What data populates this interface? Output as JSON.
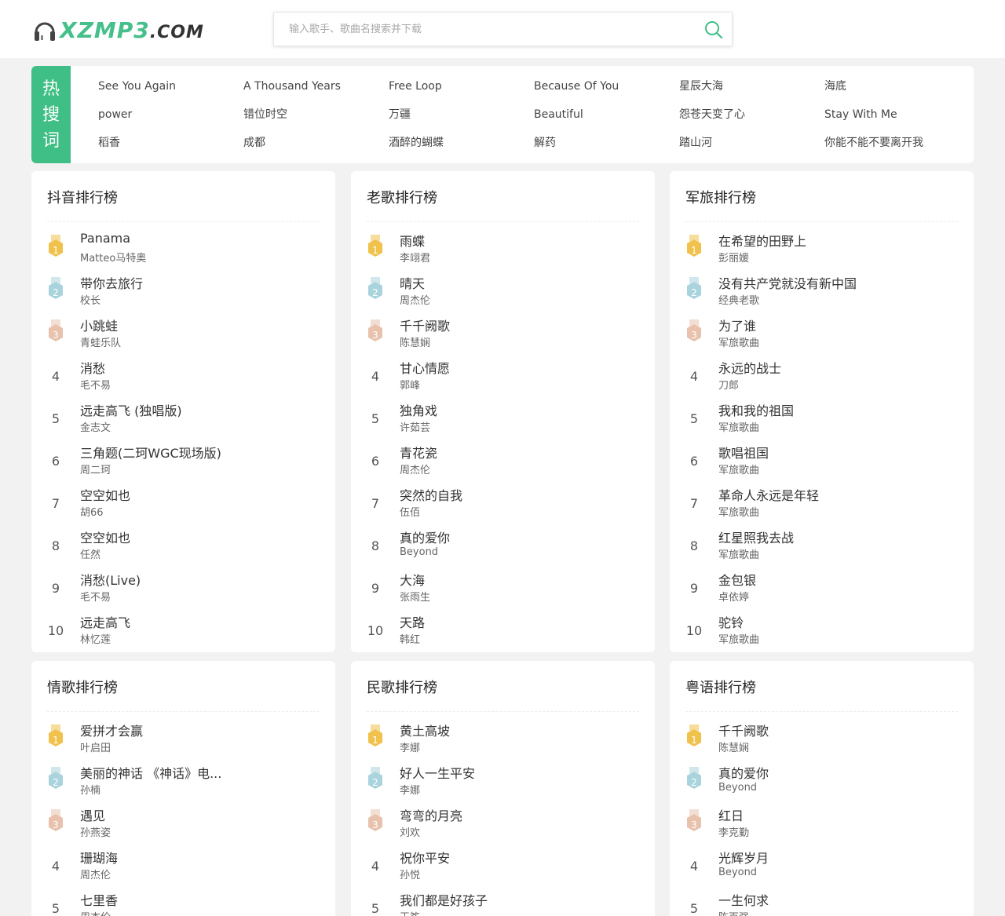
{
  "header": {
    "logo_main": "XZMP3",
    "logo_suffix": ".COM",
    "search_placeholder": "输入歌手、歌曲名搜索并下载"
  },
  "hot": {
    "label": [
      "热",
      "搜",
      "词"
    ],
    "keywords": [
      "See You Again",
      "A Thousand Years",
      "Free Loop",
      "Because Of You",
      "星辰大海",
      "海底",
      "power",
      "错位时空",
      "万疆",
      "Beautiful",
      "怨苍天变了心",
      "Stay With Me",
      "稻香",
      "成都",
      "酒醉的蝴蝶",
      "解药",
      "踏山河",
      "你能不能不要离开我"
    ]
  },
  "colors": {
    "accent": "#3fbf85",
    "gold": "#f0c14b",
    "silver": "#a9d3dd",
    "bronze": "#e8c2ad"
  },
  "panels": [
    {
      "title": "抖音排行榜",
      "items": [
        {
          "rank": "1",
          "song": "Panama",
          "artist": "Matteo马特奥"
        },
        {
          "rank": "2",
          "song": "带你去旅行",
          "artist": "校长"
        },
        {
          "rank": "3",
          "song": "小跳蛙",
          "artist": "青蛙乐队"
        },
        {
          "rank": "4",
          "song": "消愁",
          "artist": "毛不易"
        },
        {
          "rank": "5",
          "song": "远走高飞 (独唱版)",
          "artist": "金志文"
        },
        {
          "rank": "6",
          "song": "三角题(二珂WGC现场版)",
          "artist": "周二珂"
        },
        {
          "rank": "7",
          "song": "空空如也",
          "artist": "胡66"
        },
        {
          "rank": "8",
          "song": "空空如也",
          "artist": "任然"
        },
        {
          "rank": "9",
          "song": "消愁(Live)",
          "artist": "毛不易"
        },
        {
          "rank": "10",
          "song": "远走高飞",
          "artist": "林忆莲"
        }
      ]
    },
    {
      "title": "老歌排行榜",
      "items": [
        {
          "rank": "1",
          "song": "雨蝶",
          "artist": "李翊君"
        },
        {
          "rank": "2",
          "song": "晴天",
          "artist": "周杰伦"
        },
        {
          "rank": "3",
          "song": "千千阙歌",
          "artist": "陈慧娴"
        },
        {
          "rank": "4",
          "song": "甘心情愿",
          "artist": "郭峰"
        },
        {
          "rank": "5",
          "song": "独角戏",
          "artist": "许茹芸"
        },
        {
          "rank": "6",
          "song": "青花瓷",
          "artist": "周杰伦"
        },
        {
          "rank": "7",
          "song": "突然的自我",
          "artist": "伍佰"
        },
        {
          "rank": "8",
          "song": "真的爱你",
          "artist": "Beyond"
        },
        {
          "rank": "9",
          "song": "大海",
          "artist": "张雨生"
        },
        {
          "rank": "10",
          "song": "天路",
          "artist": "韩红"
        }
      ]
    },
    {
      "title": "军旅排行榜",
      "items": [
        {
          "rank": "1",
          "song": "在希望的田野上",
          "artist": "彭丽媛"
        },
        {
          "rank": "2",
          "song": "没有共产党就没有新中国",
          "artist": "经典老歌"
        },
        {
          "rank": "3",
          "song": "为了谁",
          "artist": "军旅歌曲"
        },
        {
          "rank": "4",
          "song": "永远的战士",
          "artist": "刀郎"
        },
        {
          "rank": "5",
          "song": "我和我的祖国",
          "artist": "军旅歌曲"
        },
        {
          "rank": "6",
          "song": "歌唱祖国",
          "artist": "军旅歌曲"
        },
        {
          "rank": "7",
          "song": "革命人永远是年轻",
          "artist": "军旅歌曲"
        },
        {
          "rank": "8",
          "song": "红星照我去战",
          "artist": "军旅歌曲"
        },
        {
          "rank": "9",
          "song": "金包银",
          "artist": "卓依婷"
        },
        {
          "rank": "10",
          "song": "驼铃",
          "artist": "军旅歌曲"
        }
      ]
    },
    {
      "title": "情歌排行榜",
      "items": [
        {
          "rank": "1",
          "song": "爱拼才会赢",
          "artist": "叶启田"
        },
        {
          "rank": "2",
          "song": "美丽的神话 《神话》电...",
          "artist": "孙楠"
        },
        {
          "rank": "3",
          "song": "遇见",
          "artist": "孙燕姿"
        },
        {
          "rank": "4",
          "song": "珊瑚海",
          "artist": "周杰伦"
        },
        {
          "rank": "5",
          "song": "七里香",
          "artist": "周杰伦"
        }
      ]
    },
    {
      "title": "民歌排行榜",
      "items": [
        {
          "rank": "1",
          "song": "黄土高坡",
          "artist": "李娜"
        },
        {
          "rank": "2",
          "song": "好人一生平安",
          "artist": "李娜"
        },
        {
          "rank": "3",
          "song": "弯弯的月亮",
          "artist": "刘欢"
        },
        {
          "rank": "4",
          "song": "祝你平安",
          "artist": "孙悦"
        },
        {
          "rank": "5",
          "song": "我们都是好孩子",
          "artist": "王筝"
        }
      ]
    },
    {
      "title": "粤语排行榜",
      "items": [
        {
          "rank": "1",
          "song": "千千阙歌",
          "artist": "陈慧娴"
        },
        {
          "rank": "2",
          "song": "真的爱你",
          "artist": "Beyond"
        },
        {
          "rank": "3",
          "song": "红日",
          "artist": "李克勤"
        },
        {
          "rank": "4",
          "song": "光辉岁月",
          "artist": "Beyond"
        },
        {
          "rank": "5",
          "song": "一生何求",
          "artist": "陈百强"
        }
      ]
    }
  ]
}
